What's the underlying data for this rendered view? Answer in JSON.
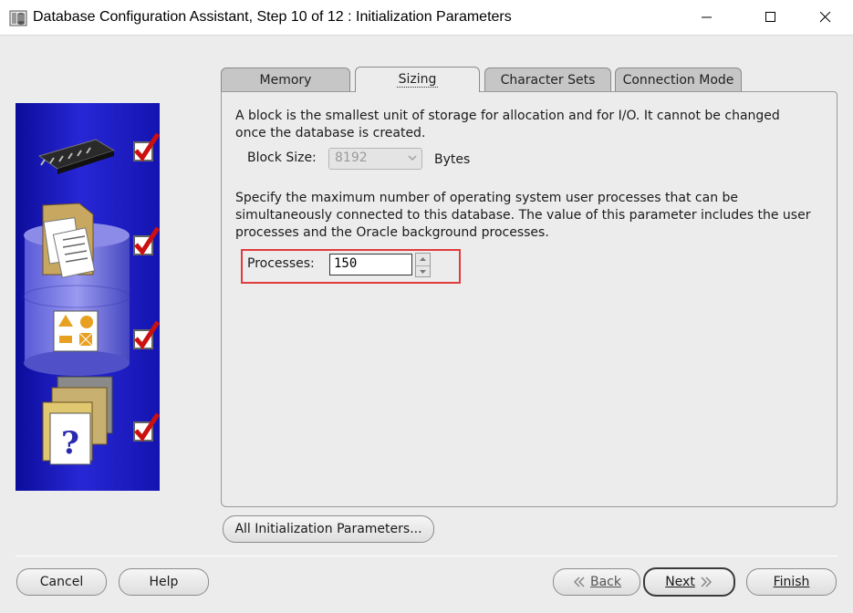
{
  "window": {
    "title": "Database Configuration Assistant, Step 10 of 12 : Initialization Parameters"
  },
  "tabs": [
    {
      "label": "Memory",
      "active": false
    },
    {
      "label": "Sizing",
      "active": true
    },
    {
      "label": "Character Sets",
      "active": false
    },
    {
      "label": "Connection Mode",
      "active": false
    }
  ],
  "sizing": {
    "block_desc_line1": "A block is the smallest unit of storage for allocation and for I/O. It cannot be changed",
    "block_desc_line2": "once the database is created.",
    "block_size_label": "Block Size:",
    "block_size_value": "8192",
    "block_size_unit": "Bytes",
    "proc_desc_line1": "Specify the maximum number of operating system user processes that can be",
    "proc_desc_line2": "simultaneously connected to this database. The value of this parameter includes the user",
    "proc_desc_line3": "processes and the Oracle background processes.",
    "processes_label": "Processes:",
    "processes_value": "150"
  },
  "buttons": {
    "all_params": "All Initialization Parameters...",
    "cancel": "Cancel",
    "help": "Help",
    "back": "Back",
    "next": "Next",
    "finish": "Finish"
  },
  "colors": {
    "highlight": "#e03c3c",
    "art_blue": "#1a1ac4",
    "check_red": "#cc1010"
  }
}
